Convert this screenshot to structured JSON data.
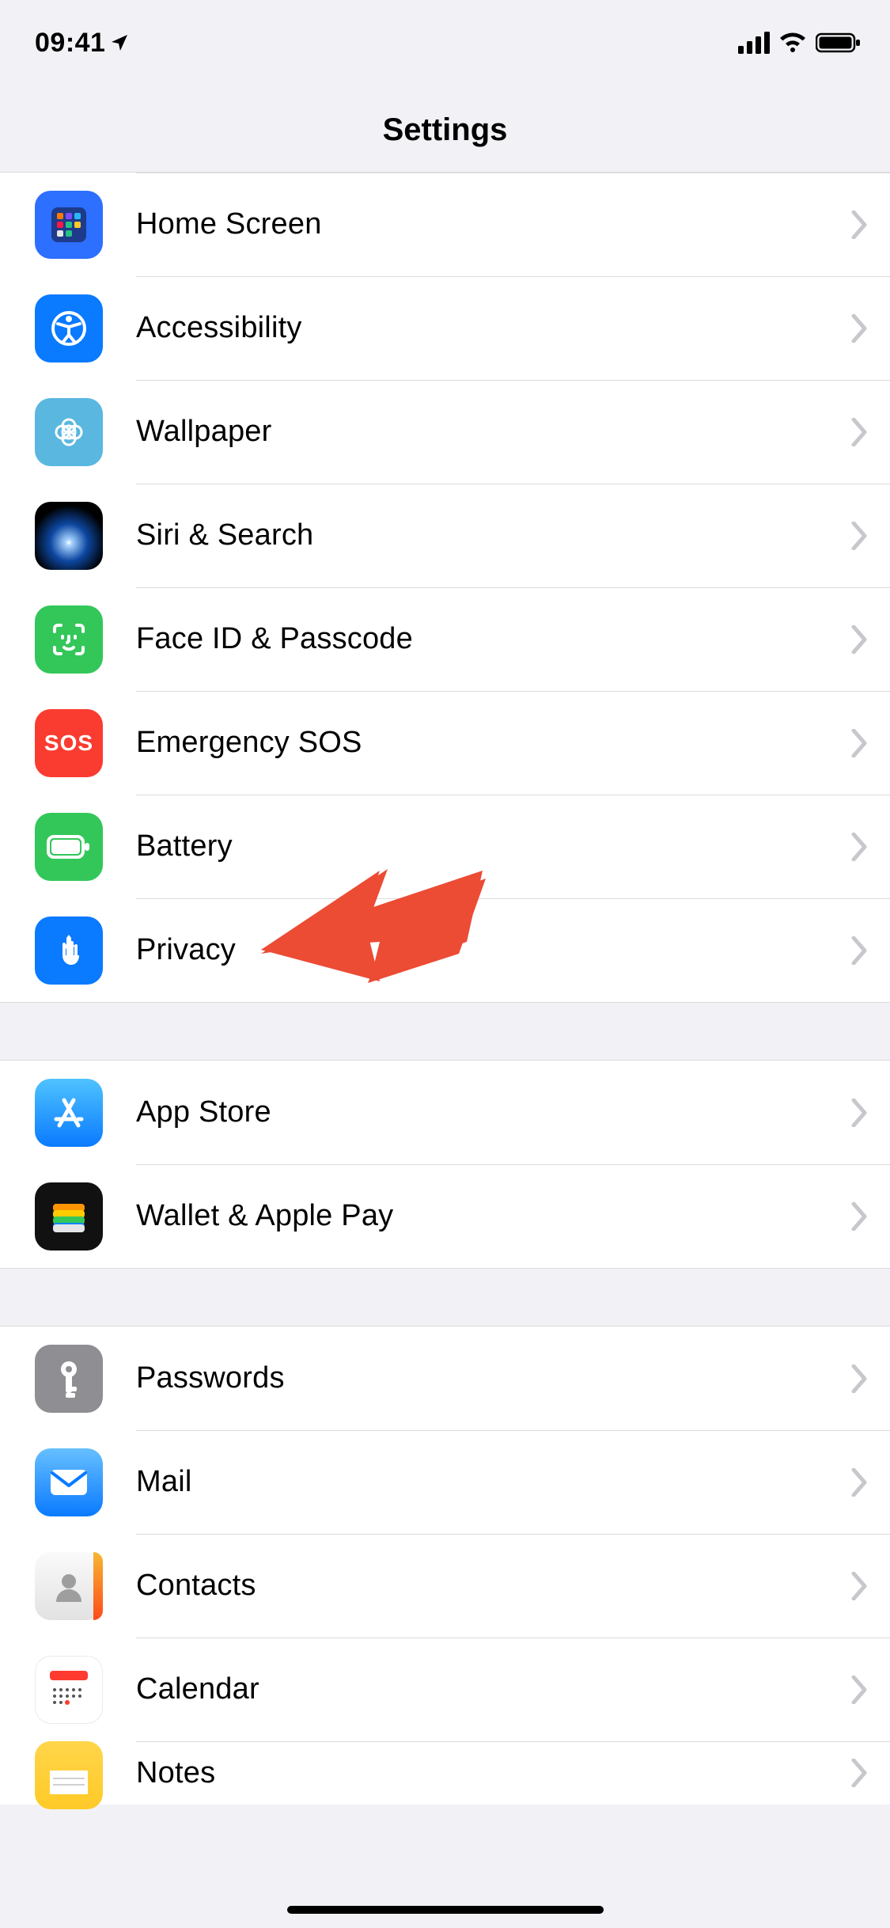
{
  "status": {
    "time": "09:41"
  },
  "header": {
    "title": "Settings"
  },
  "groups": [
    {
      "id": "g1",
      "items": [
        {
          "id": "home-screen",
          "label": "Home Screen",
          "icon": "home-screen-icon"
        },
        {
          "id": "accessibility",
          "label": "Accessibility",
          "icon": "accessibility-icon"
        },
        {
          "id": "wallpaper",
          "label": "Wallpaper",
          "icon": "wallpaper-icon"
        },
        {
          "id": "siri-search",
          "label": "Siri & Search",
          "icon": "siri-icon"
        },
        {
          "id": "face-id",
          "label": "Face ID & Passcode",
          "icon": "face-id-icon"
        },
        {
          "id": "sos",
          "label": "Emergency SOS",
          "icon": "sos-icon"
        },
        {
          "id": "battery",
          "label": "Battery",
          "icon": "battery-icon"
        },
        {
          "id": "privacy",
          "label": "Privacy",
          "icon": "privacy-icon"
        }
      ]
    },
    {
      "id": "g2",
      "items": [
        {
          "id": "app-store",
          "label": "App Store",
          "icon": "app-store-icon"
        },
        {
          "id": "wallet",
          "label": "Wallet & Apple Pay",
          "icon": "wallet-icon"
        }
      ]
    },
    {
      "id": "g3",
      "items": [
        {
          "id": "passwords",
          "label": "Passwords",
          "icon": "passwords-icon"
        },
        {
          "id": "mail",
          "label": "Mail",
          "icon": "mail-icon"
        },
        {
          "id": "contacts",
          "label": "Contacts",
          "icon": "contacts-icon"
        },
        {
          "id": "calendar",
          "label": "Calendar",
          "icon": "calendar-icon"
        },
        {
          "id": "notes",
          "label": "Notes",
          "icon": "notes-icon"
        }
      ]
    }
  ],
  "annotation": {
    "target": "privacy",
    "pointer_color": "#ec4b34"
  }
}
